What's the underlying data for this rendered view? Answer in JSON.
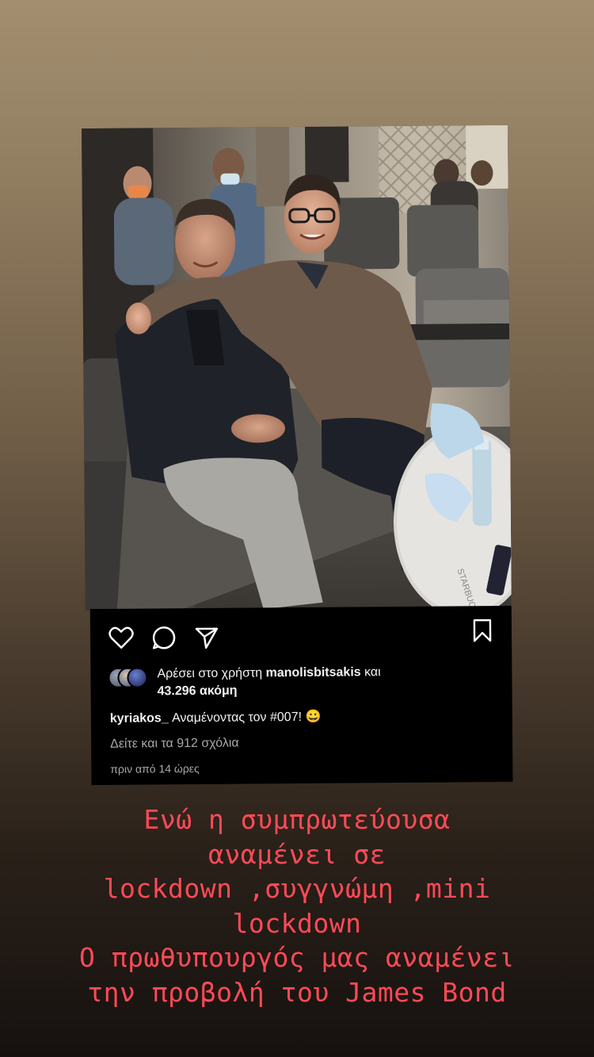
{
  "post": {
    "liked_by_prefix": "Αρέσει στο χρήστη ",
    "liked_by_user": "manolisbitsakis",
    "liked_by_suffix": " και",
    "likes_count": "43.296 ακόμη",
    "author": "kyriakos_",
    "caption": " Αναμένοντας τον #007! 😀",
    "comments": "Δείτε και τα 912 σχόλια",
    "timestamp": "πριν από 14 ώρες",
    "icons": [
      "heart-icon",
      "comment-icon",
      "share-icon",
      "bookmark-icon"
    ]
  },
  "photo": {
    "table_text": "STARBUCKS"
  },
  "story_text": {
    "lines": [
      "Ενώ η συμπρωτεύουσα",
      "αναμένει σε",
      "lockdown ,συγγνώμη ,mini",
      "lockdown",
      "Ο πρωθυπουργός μας αναμένει",
      "την προβολή του James Bond"
    ],
    "color": "#ff4a57"
  }
}
